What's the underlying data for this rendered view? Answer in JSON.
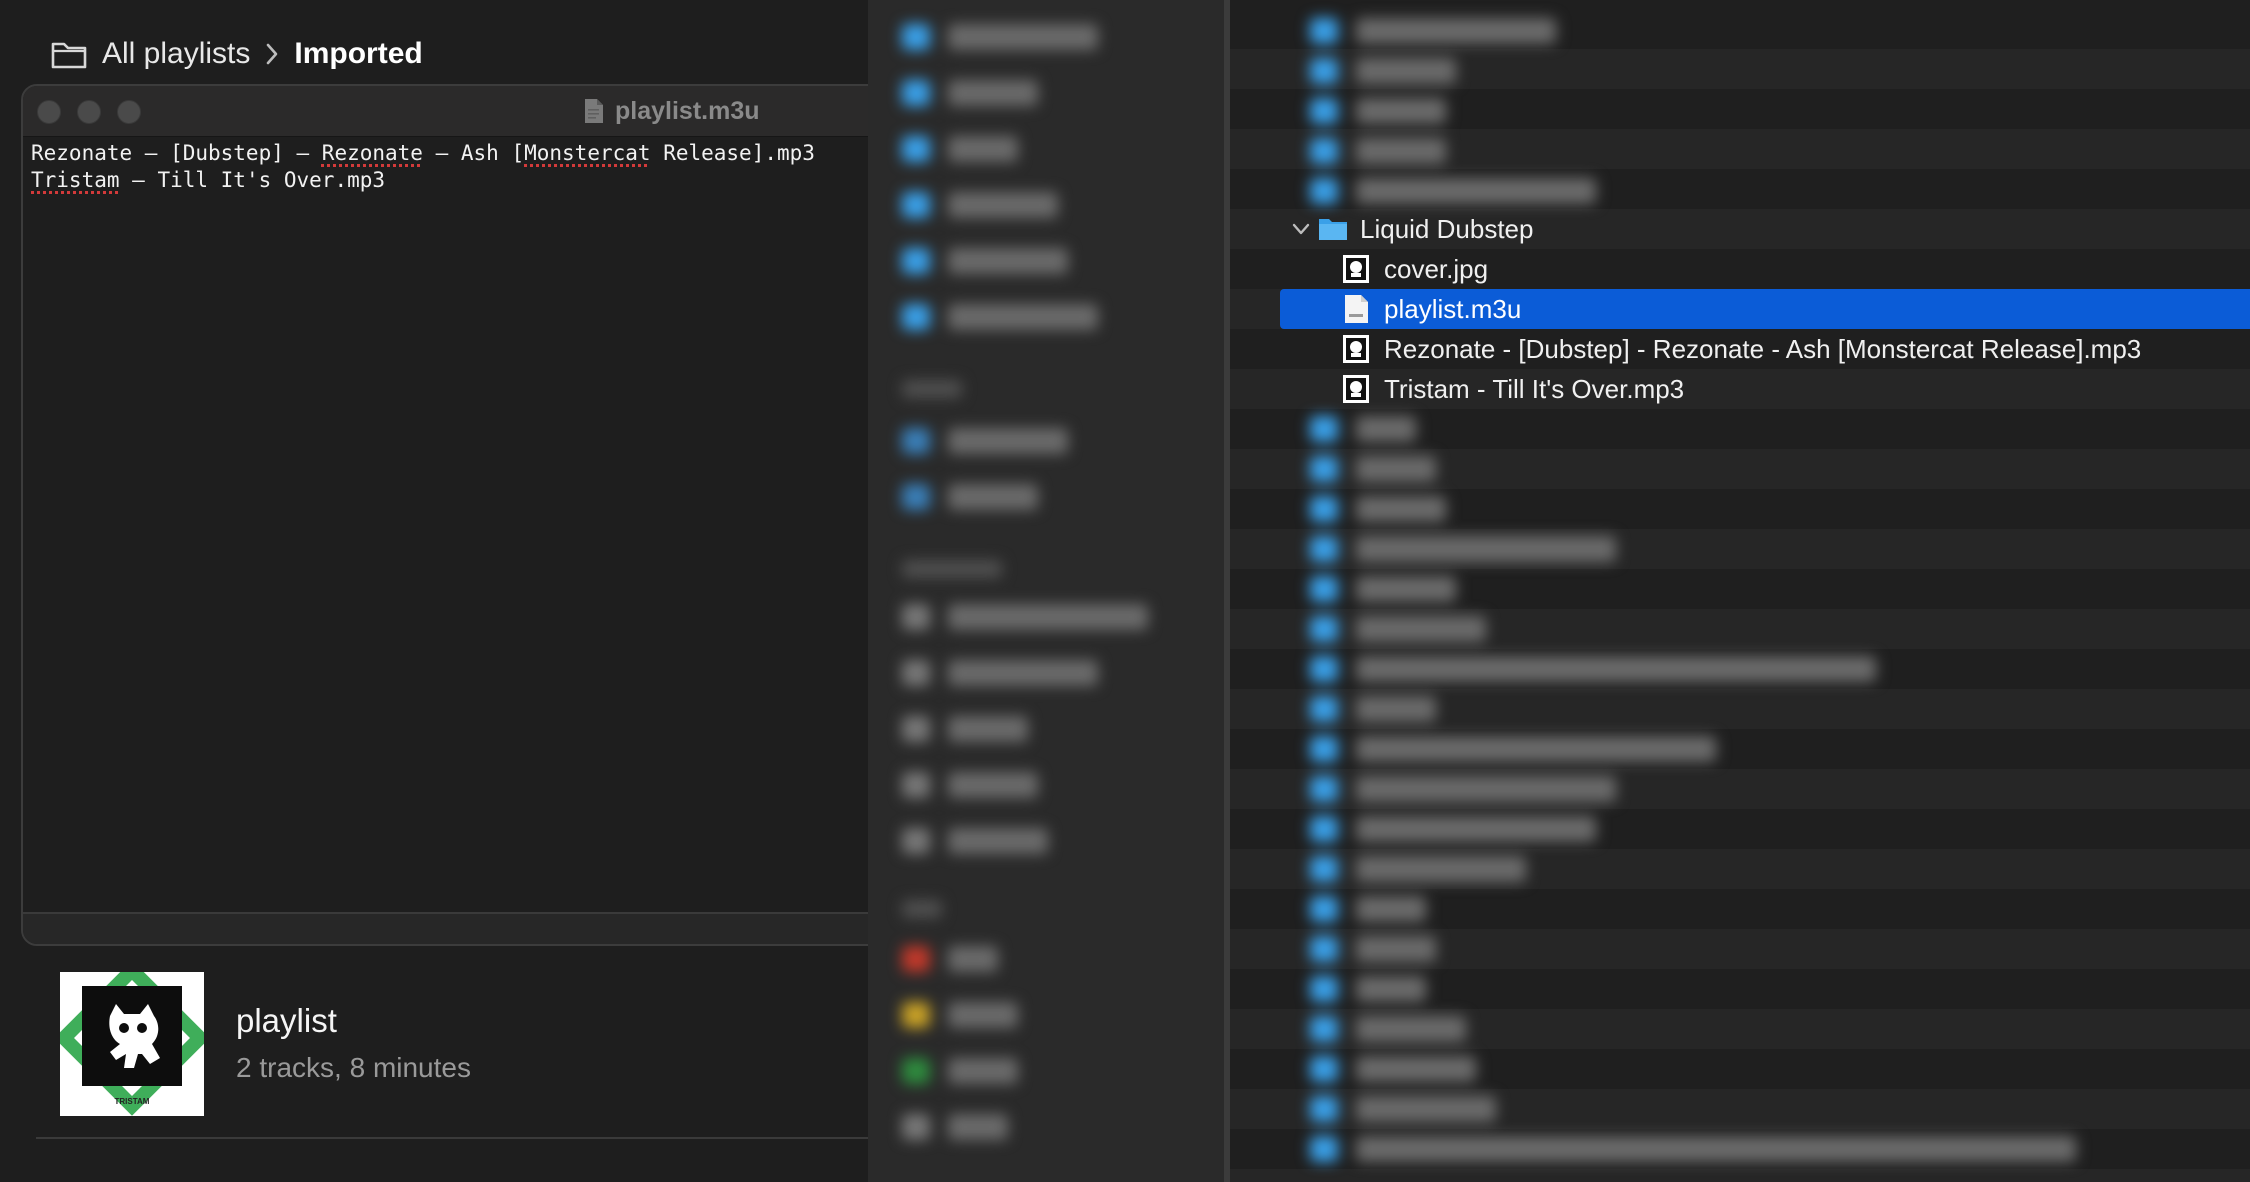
{
  "breadcrumb": {
    "parent": "All playlists",
    "current": "Imported"
  },
  "editor": {
    "title": "playlist.m3u",
    "lines": [
      {
        "parts": [
          {
            "text": "Rezonate – [Dubstep] – ",
            "spell": false
          },
          {
            "text": "Rezonate",
            "spell": true
          },
          {
            "text": " – Ash [",
            "spell": false
          },
          {
            "text": "Monstercat",
            "spell": true
          },
          {
            "text": " Release].mp3",
            "spell": false
          }
        ]
      },
      {
        "parts": [
          {
            "text": "Tristam",
            "spell": true
          },
          {
            "text": " – Till It's Over.mp3",
            "spell": false
          }
        ]
      }
    ]
  },
  "now_playing": {
    "title": "playlist",
    "subtitle": "2 tracks, 8 minutes",
    "art_caption": "TRISTAM"
  },
  "finder": {
    "folder": "Liquid Dubstep",
    "files": [
      {
        "name": "cover.jpg",
        "icon": "image-file-icon",
        "selected": false
      },
      {
        "name": "playlist.m3u",
        "icon": "m3u-file-icon",
        "selected": true
      },
      {
        "name": "Rezonate - [Dubstep] - Rezonate - Ash [Monstercat Release].mp3",
        "icon": "audio-file-icon",
        "selected": false
      },
      {
        "name": "Tristam - Till It's Over.mp3",
        "icon": "audio-file-icon",
        "selected": false
      }
    ]
  },
  "colors": {
    "selection": "#0b5cd7",
    "folder_blue": "#3aa0e8",
    "tag_red": "#c0392b",
    "tag_yellow": "#c9a227",
    "tag_green": "#2e8b3e",
    "album_green": "#3fae5a"
  }
}
